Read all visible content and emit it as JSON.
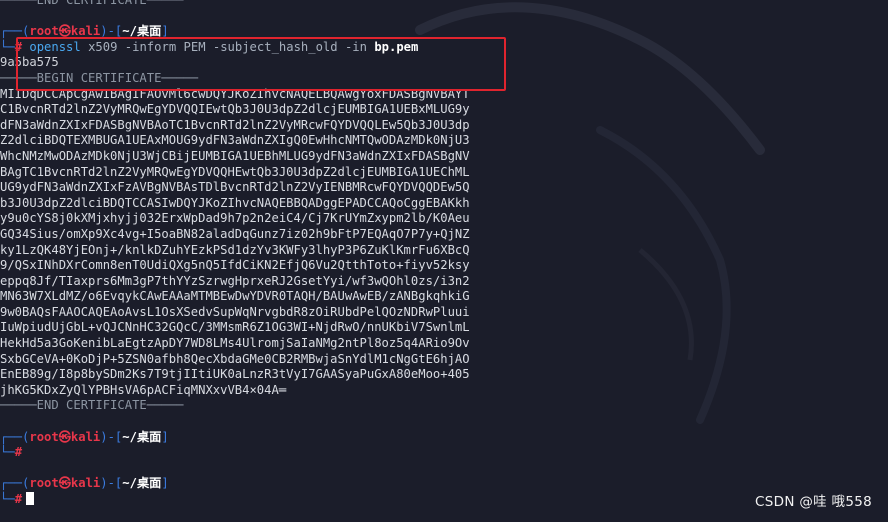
{
  "top_end_marker": "─────END CERTIFICATE─────",
  "prompt": {
    "corner_top": "┌──(",
    "user": "root㉿kali",
    "sep1": ")-[",
    "path": "~/桌面",
    "sep2": "]",
    "corner_bottom": "└─",
    "hash": "#"
  },
  "command": {
    "prog": "openssl",
    "arg1": "x509",
    "flag1": "-inform",
    "val1": "PEM",
    "flag2": "-subject_hash_old",
    "flag3": "-in",
    "file": "bp.pem"
  },
  "output": {
    "hash": "9a5ba575",
    "begin_marker": "─────BEGIN CERTIFICATE─────",
    "cert_lines": [
      "MIIDqDCCApCgAwIBAgIFAOvMl6cwDQYJKoZIhvcNAQELBQAwgYoxFDASBgNVBAYT",
      "C1BvcnRTd2lnZ2VyMRQwEgYDVQQIEwtQb3J0U3dpZ2dlcjEUMBIGA1UEBxMLUG9y",
      "dFN3aWdnZXIxFDASBgNVBAoTC1BvcnRTd2lnZ2VyMRcwFQYDVQQLEw5Qb3J0U3dp",
      "Z2dlciBDQTEXMBUGA1UEAxMOUG9ydFN3aWdnZXIgQ0EwHhcNMTQwODAzMDk0NjU3",
      "WhcNMzMwODAzMDk0NjU3WjCBijEUMBIGA1UEBhMLUG9ydFN3aWdnZXIxFDASBgNV",
      "BAgTC1BvcnRTd2lnZ2VyMRQwEgYDVQQHEwtQb3J0U3dpZ2dlcjEUMBIGA1UEChML",
      "UG9ydFN3aWdnZXIxFzAVBgNVBAsTDlBvcnRTd2lnZ2VyIENBMRcwFQYDVQQDEw5Q",
      "b3J0U3dpZ2dlciBDQTCCASIwDQYJKoZIhvcNAQEBBQADggEPADCCAQoCggEBAKkh",
      "y9u0cYS8j0kXMjxhyjj032ErxWpDad9h7p2n2eiC4/Cj7KrUYmZxypm2lb/K0Aeu",
      "GQ34Sius/omXp9Xc4vg+I5oaBN82aladDqGunz7iz02h9bFtP7EQAqO7P7y+QjNZ",
      "ky1LzQK48YjEOnj+/knlkDZuhYEzkPSd1dzYv3KWFy3lhyP3P6ZuKlKmrFu6XBcQ",
      "9/QSxINhDXrComn8enT0UdiQXg5nQ5IfdCiKN2EfjQ6Vu2QtthToto+fiyv52ksy",
      "eppq8Jf/TIaxprs6Mm3gP7thYYzSzrwgHprxeRJ2GsetYyi/wf3wQOhl0zs/i3n2",
      "MN63W7XLdMZ/o6EvqykCAwEAAaMTMBEwDwYDVR0TAQH/BAUwAwEB/zANBgkqhkiG",
      "9w0BAQsFAAOCAQEAoAvsL1OsXSedvSupWqNrvgbdR8zOiRUbdPelQOzNDRwPluui",
      "IuWpiudUjGbL+vQJCNnHC32GQcC/3MMsmR6Z1OG3WI+NjdRwO/nnUKbiV7SwnlmL",
      "HekHd5a3GoKenibLaEgtzApDY7WD8LMs4UlromjSaIaNMg2ntPl8oz5q4ARio9Ov",
      "SxbGCeVA+0KoDjP+5ZSN0afbh8QecXbdaGMe0CB2RMBwjaSnYdlM1cNgGtE6hjAO",
      "EnEB89g/I8p8bySDm2Ks7T9tjIItiUK0aLnzR3tVyI7GAASyaPuGxA80eMoo+405",
      "jhKG5KDxZyQlYPBHsVA6pACFiqMNXxvVB4×04A═"
    ],
    "end_marker": "─────END CERTIFICATE─────"
  },
  "watermark": "CSDN @哇 哦558",
  "colors": {
    "background": "#1b1d2a",
    "highlight_box": "#e0242e",
    "prompt_user": "#e8364a",
    "prompt_frame": "#3b7ce0"
  }
}
